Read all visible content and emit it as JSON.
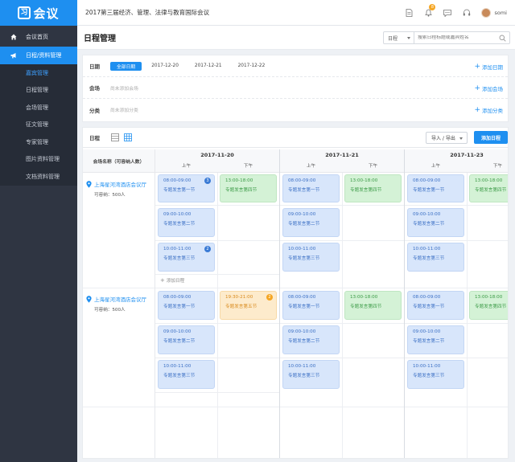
{
  "brand": {
    "logo_text": "会议",
    "logo_mark": "习"
  },
  "topbar": {
    "conference_title": "2017第三届经济、管理、法律与教育国际会议",
    "badge_count": "8",
    "username": "somi"
  },
  "sidebar": {
    "items": [
      {
        "label": "会议首页",
        "icon": "home-icon"
      },
      {
        "label": "日程/资料管理",
        "icon": "megaphone-icon",
        "active": true
      }
    ],
    "sub_items": [
      {
        "label": "嘉宾管理",
        "active": true
      },
      {
        "label": "日程管理"
      },
      {
        "label": "会场管理"
      },
      {
        "label": "征文管理"
      },
      {
        "label": "专家管理"
      },
      {
        "label": "图片资料管理"
      },
      {
        "label": "文档资料管理"
      }
    ]
  },
  "page": {
    "title": "日程管理"
  },
  "search": {
    "select_value": "日程",
    "placeholder": "搜索日程标题或嘉宾姓名"
  },
  "filters": {
    "date": {
      "label": "日期",
      "options": [
        "全部日期",
        "2017-12-20",
        "2017-12-21",
        "2017-12-22"
      ],
      "add": "添加日期"
    },
    "venue": {
      "label": "会场",
      "hint": "尚未添加会场",
      "add": "添加会场"
    },
    "category": {
      "label": "分类",
      "hint": "尚未添加分类",
      "add": "添加分类"
    }
  },
  "schedule": {
    "label": "日程",
    "import_export": "导入 / 导出",
    "add_button": "添加日程",
    "venue_header": "会场名称（可容纳人数）",
    "am": "上午",
    "pm": "下午",
    "add_row": "添加日程",
    "days": [
      "2017-11-20",
      "2017-11-21",
      "2017-11-23"
    ],
    "venues": [
      {
        "name": "上海星河湾酒店会议厅",
        "capacity": "可容纳：500人"
      },
      {
        "name": "上海星河湾酒店会议厅",
        "capacity": "可容纳：500人"
      }
    ],
    "events": {
      "e0800": {
        "time": "08:00-09:00",
        "name": "专题发言第一节"
      },
      "e0900": {
        "time": "09:00-10:00",
        "name": "专题发言第二节"
      },
      "e1000": {
        "time": "10:00-11:00",
        "name": "专题发言第三节"
      },
      "e1300": {
        "time": "13:00-18:00",
        "name": "专题发言第四节"
      },
      "e1930": {
        "time": "19:30-21:00",
        "name": "专题发言第五节"
      }
    },
    "counts": {
      "c3": "3",
      "c2": "2"
    }
  },
  "colors": {
    "accent": "#1e8ff0",
    "sidebar_bg": "#2f3542",
    "event_blue": "#d8e6fb",
    "event_green": "#d4f2d6",
    "event_orange": "#fdebcc"
  }
}
